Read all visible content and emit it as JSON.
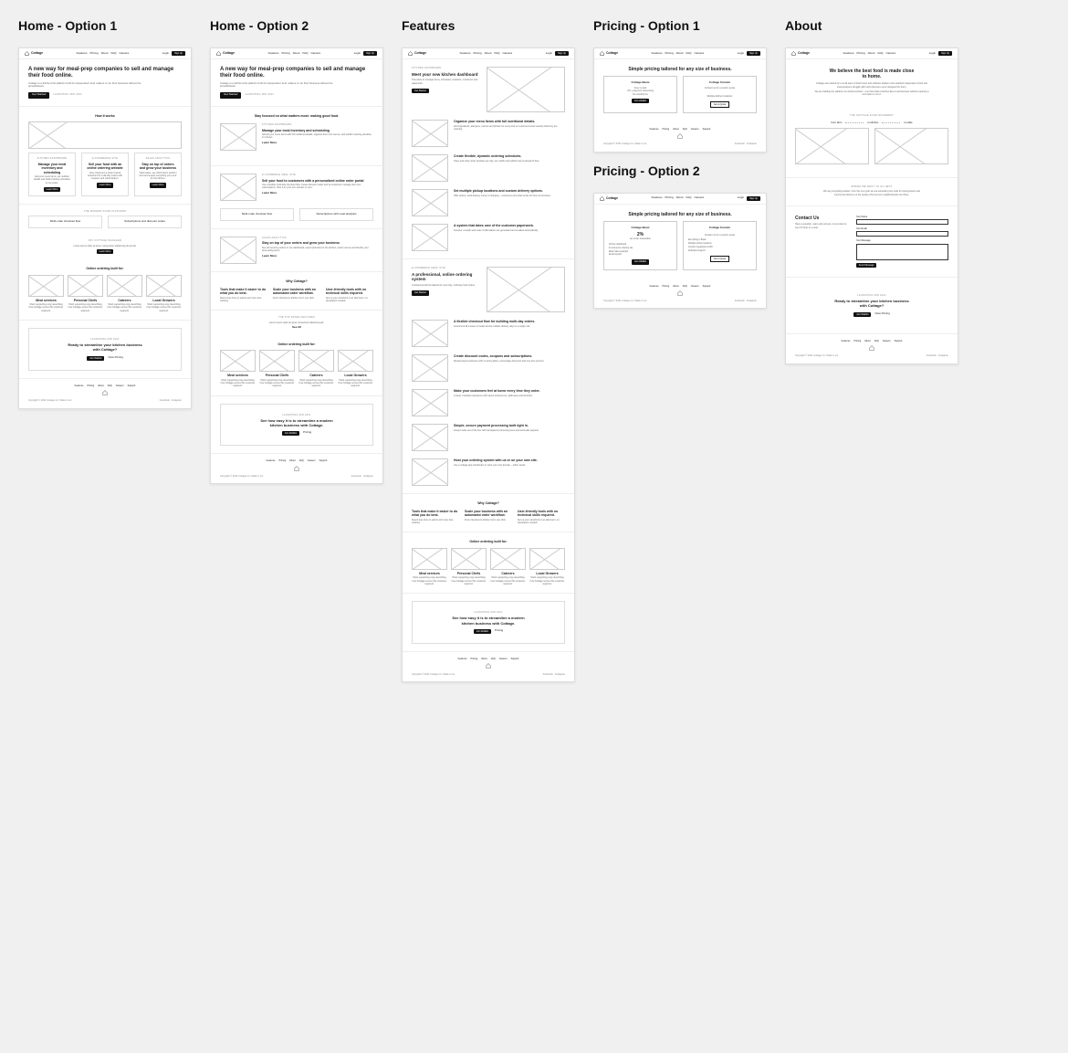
{
  "titles": {
    "home1": "Home - Option 1",
    "home2": "Home - Option 2",
    "features": "Features",
    "pricing1": "Pricing - Option 1",
    "pricing2": "Pricing - Option 2",
    "about": "About"
  },
  "brand": "Cottage",
  "nav": {
    "links": [
      "Features",
      "Pricing",
      "About",
      "FAQ",
      "Careers"
    ],
    "login": "Login",
    "signup": "Sign Up"
  },
  "home": {
    "hero_title": "A new way for meal-prep companies to sell and manage their food online.",
    "hero_sub": "Cottage is a kitchen-first platform built for independent food makers to run their business without the spreadsheets.",
    "cta_primary": "Get Started",
    "cta_secondary": "LAUNCHING MID 2021",
    "how_title": "How it works",
    "how_items": [
      {
        "eyebrow": "KITCHEN DASHBOARD",
        "title": "Manage your meal inventory and scheduling",
        "body": "Add your menu items, set nutrition details and build ordering schedules in one place.",
        "cta": "Learn More"
      },
      {
        "eyebrow": "E-COMMERCE SITE",
        "title": "Sell your food with an online ordering website",
        "body": "Give customers a clean hosted storefront for multi-day orders with coupons and subscriptions.",
        "cta": "Learn More"
      },
      {
        "eyebrow": "SALES ANALYTICS",
        "title": "Stay on top of orders and grow your business",
        "body": "Track sales, see which items perform best and export everything you need for the kitchen.",
        "cta": "Learn More"
      }
    ],
    "platform_eyebrow": "THE MODERN FOOD PLATFORM",
    "platform_boxes": [
      "Multi-order checkout flow",
      "Subscriptions and discount codes"
    ],
    "manager_eyebrow": "PAY COTTAGE MANAGER",
    "manager_body": "Lorem ipsum dolor sit amet, consectetur adipiscing elit sed do.",
    "manager_cta": "Learn More",
    "built_title": "Online ordering built for:",
    "built_items": [
      "Meal services",
      "Personal Chefs",
      "Caterers",
      "Local Growers"
    ],
    "built_body": "Short supporting copy describing how Cottage serves this customer segment.",
    "cta_eyebrow": "LAUNCHING MID 2021",
    "cta_title": "Ready to streamline your kitchen business with Cottage?",
    "cta_btn1": "Join Waitlist",
    "cta_btn2": "View Pricing"
  },
  "home2": {
    "focus_title": "Stay focused on what matters most: making good food.",
    "section1": {
      "eyebrow": "KITCHEN DASHBOARD",
      "title": "Manage your meal inventory and scheduling",
      "body": "Add all your menu items with full nutritional details, organize them into menus, and publish ordering windows in minutes.",
      "link": "Learn More"
    },
    "section2": {
      "eyebrow": "E-COMMERCE MEAL SITE",
      "title": "Sell your food to customers with a personalized online order portal",
      "body": "Use a flexible multi-day checkout flow, create discount codes and let customers manage their own subscriptions. Host it on your own domain or ours.",
      "link": "Learn More"
    },
    "section2_boxes": [
      "Multi-order checkout flow",
      "Subscriptions with meal analytics"
    ],
    "section3": {
      "eyebrow": "SALES ANALYTICS",
      "title": "Stay on top of your orders and grow your business",
      "body": "See all incoming orders in one dashboard, export pick-lists for the kitchen, track revenue and identify your best-selling items.",
      "link": "Learn More"
    },
    "why_title": "Why Cottage?",
    "why_items": [
      {
        "title": "Tools that make it easier to do what you do best.",
        "body": "Spend less time on admin and more time cooking."
      },
      {
        "title": "Scale your business with an automated order workflow.",
        "body": "From checkout to kitchen list in one click."
      },
      {
        "title": "User-friendly tools with no technical skills required.",
        "body": "Set up your storefront in an afternoon, no developers needed."
      }
    ],
    "tip_eyebrow": "THE TOP RATED FEATURES",
    "tip_body": "Lorem ipsum dolor sit amet consectetur adipiscing elit.",
    "tip_link": "See All",
    "cta_eyebrow": "LAUNCHING MID 2021",
    "cta_title": "See how easy it is to streamline a modern kitchen business with Cottage.",
    "cta_btn1": "Join Waitlist",
    "cta_btn2": "Pricing"
  },
  "features": {
    "dash_eyebrow": "KITCHEN DASHBOARD",
    "dash_title": "Meet your new kitchen dashboard",
    "dash_body": "One place to manage items, schedules, locations, customers and paperwork.",
    "dash_cta": "Get Started",
    "dash_items": [
      {
        "title": "Organize your menu items with full nutritional details.",
        "body": "Add ingredients, allergens, macros and photos for every dish so customers know exactly what they are ordering."
      },
      {
        "title": "Create flexible, dynamic ordering schedules.",
        "body": "Open and close order windows per day, set cutoffs and publish menus ahead of time."
      },
      {
        "title": "Set multiple pickup locations and custom delivery options.",
        "body": "Offer pickup, local delivery zones or shipping – customers pick what works for them at checkout."
      },
      {
        "title": "A system that takes care of the customer paperwork.",
        "body": "Invoices, receipts and order confirmations are generated and emailed automatically."
      }
    ],
    "site_eyebrow": "E-COMMERCE MEAL SITE",
    "site_title": "A professional, online ordering system",
    "site_body": "A hosted storefront tailored for recurring, multi-day food orders.",
    "site_cta": "Get Started",
    "site_items": [
      {
        "title": "A flexible checkout flow for building multi-day orders.",
        "body": "Customers fill a week of meals across multiple delivery days in a single cart."
      },
      {
        "title": "Create discount codes, coupons and subscriptions.",
        "body": "Reward loyal customers with recurring plans, percentage discounts and one-time promos."
      },
      {
        "title": "Make your customers feel at home every time they order.",
        "body": "A clean, branded experience with saved preferences, addresses and favorites."
      },
      {
        "title": "Simple, secure payment processing built right in.",
        "body": "Accept cards out of the box with transparent processing fees and automatic payouts."
      },
      {
        "title": "Host your ordering system with us or on your own site.",
        "body": "Use a cottage.app subdomain or point your own domain – either works."
      }
    ]
  },
  "pricing": {
    "title": "Simple pricing tailored for any size of business.",
    "plans": [
      {
        "name": "Cottage Basic",
        "price_pct": "2%",
        "price_note": "per order transaction",
        "items": [
          "Kitchen dashboard",
          "E-commerce ordering site",
          "Basic sales analytics",
          "Email support"
        ],
        "cta": "Join Waitlist"
      },
      {
        "name": "Cottage Custom",
        "price_note": "Contact us for a custom quote",
        "items": [
          "Everything in Basic",
          "Multiple kitchen locations",
          "Custom integrations & API",
          "Dedicated support"
        ],
        "cta": "Get a Quote"
      }
    ],
    "plan1_sub": "Free to start",
    "plan1_rate": "2% + payment processing",
    "plan1_note": "No monthly fee"
  },
  "about": {
    "hero_title": "We believe the best food is made close to home.",
    "hero_body1": "Cottage was started by a small team of food lovers and software builders who watched independent chefs and meal-preppers struggle with tools that were never designed for them.",
    "hero_body2": "We are building the platform we wished existed – one that treats a kitchen like a real business without requiring a tech team to run it.",
    "movement_eyebrow": "THE COTTAGE FOOD MOVEMENT",
    "chain": [
      "from farm",
      "to kitchen",
      "to table"
    ],
    "next_eyebrow": "WHERE WE WANT TO GO NEXT",
    "next_body": "We are just getting started. Over the next year we are expanding into tools for local growers and community kitchens so the people who feed our neighborhoods can thrive.",
    "contact_title": "Contact Us",
    "contact_sub": "Have a question, want early access, or just want to say hi? Drop us a note.",
    "labels": {
      "name": "Your Name",
      "email": "Your Email",
      "msg": "Your Message"
    },
    "submit": "Send Message",
    "cta_eyebrow": "LAUNCHING MID 2021",
    "cta_title": "Ready to streamline your kitchen business with Cottage?",
    "cta_btn1": "Join Waitlist",
    "cta_btn2": "View Pricing"
  },
  "footer": {
    "links": [
      "Features",
      "Pricing",
      "About",
      "FAQ",
      "Careers",
      "Support"
    ],
    "copy": "Copyright © 2021 Cottage Inc. Made in LA.",
    "right": [
      "Facebook",
      "Instagram"
    ]
  }
}
